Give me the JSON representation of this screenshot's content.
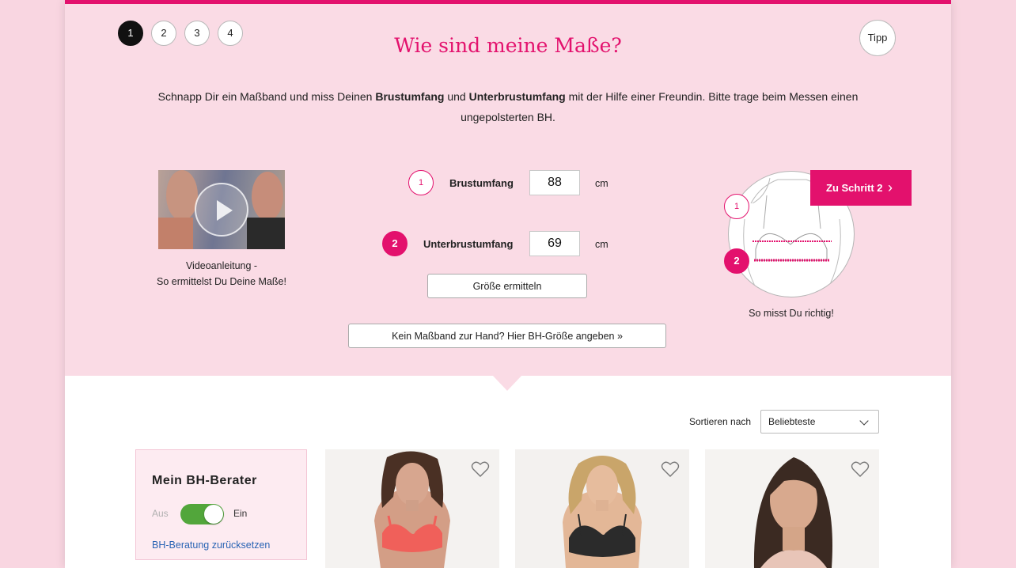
{
  "wizard": {
    "steps": [
      "1",
      "2",
      "3",
      "4"
    ],
    "active_step": 1,
    "tip_label": "Tipp",
    "title": "Wie sind meine Maße?",
    "intro": {
      "p1": "Schnapp Dir ein Maßband und miss Deinen ",
      "b1": "Brustumfang",
      "p2": " und ",
      "b2": "Unterbrustumfang",
      "p3": " mit der Hilfe einer Freundin. Bitte trage beim Messen einen ungepolsterten BH."
    },
    "video": {
      "caption_line1": "Videoanleitung -",
      "caption_line2": "So ermittelst Du Deine Maße!"
    },
    "fields": [
      {
        "number": "1",
        "label": "Brustumfang",
        "value": "88",
        "unit": "cm"
      },
      {
        "number": "2",
        "label": "Unterbrustumfang",
        "value": "69",
        "unit": "cm"
      }
    ],
    "calc_button": "Größe ermitteln",
    "no_tape_button": "Kein Maßband zur Hand? Hier BH-Größe angeben »",
    "next_button": "Zu Schritt 2",
    "illustration": {
      "marker1": "1",
      "marker2": "2",
      "caption": "So misst Du richtig!"
    }
  },
  "listing": {
    "sort_label": "Sortieren nach",
    "sort_value": "Beliebteste",
    "advisor": {
      "title": "Mein BH-Berater",
      "toggle_off_label": "Aus",
      "toggle_on_label": "Ein",
      "toggle_state": "on",
      "reset_link": "BH-Beratung zurücksetzen"
    },
    "products": [
      {
        "name": "product-1",
        "bra_color": "#f0605a"
      },
      {
        "name": "product-2",
        "bra_color": "#2b2b2b"
      },
      {
        "name": "product-3",
        "bra_color": "#e8c5b8"
      }
    ]
  },
  "colors": {
    "accent": "#e3116d",
    "wizard_bg": "#fadbe5",
    "page_bg": "#f9d6e1",
    "toggle_on": "#52a63b",
    "link": "#2a64b4"
  }
}
